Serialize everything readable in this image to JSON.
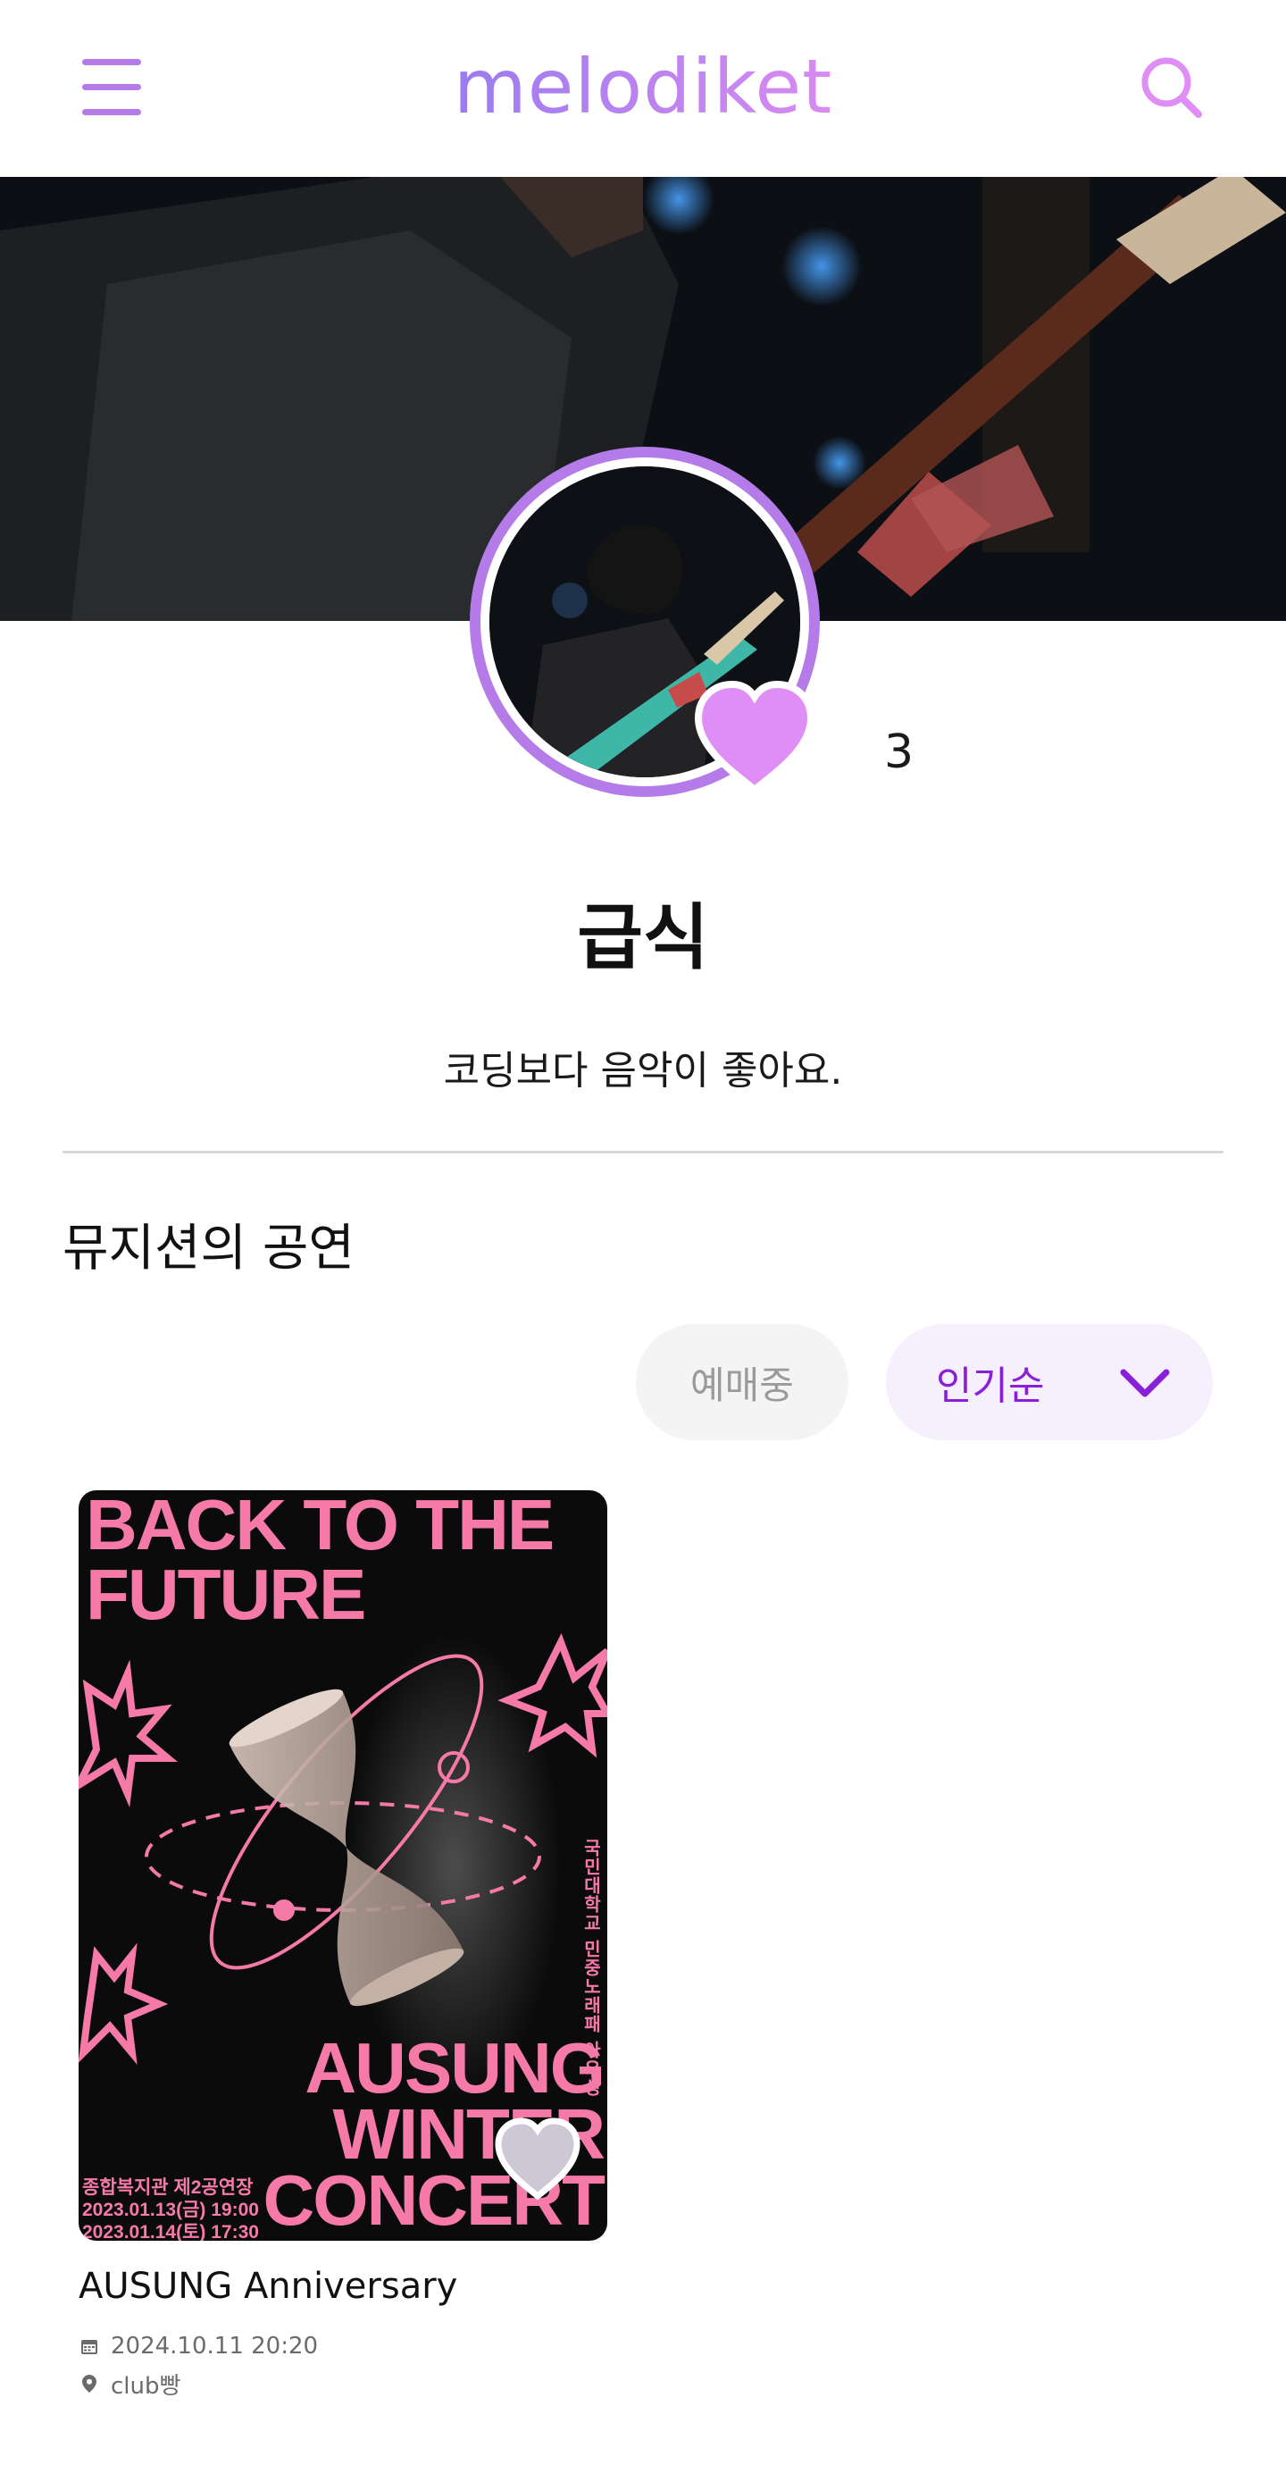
{
  "header": {
    "logo": "melodiket",
    "menu_icon": "hamburger-menu-icon",
    "search_icon": "search-icon"
  },
  "artist": {
    "name": "급식",
    "bio": "코딩보다 음악이 좋아요.",
    "like_count": "3"
  },
  "section": {
    "title": "뮤지션의 공연"
  },
  "filters": {
    "status_label": "예매중",
    "sort_label": "인기순"
  },
  "concerts": [
    {
      "title": "AUSUNG Anniversary",
      "datetime": "2024.10.11 20:20",
      "venue": "club빵",
      "poster": {
        "headline_1": "BACK TO THE",
        "headline_2": "FUTURE",
        "concert_1": "AUSUNG",
        "concert_2": "WINTER",
        "concert_3": "CONCERT",
        "info_1": "종합복지관 제2공연장",
        "info_2": "2023.01.13(금) 19:00",
        "info_3": "2023.01.14(토) 17:30",
        "vertical": "국민대학교 민중노래패 아우성"
      }
    }
  ],
  "colors": {
    "brand": "#b57be8",
    "brand_dark": "#8a1fd8",
    "heart": "#df8ef6",
    "poster_pink": "#f57aa8"
  }
}
